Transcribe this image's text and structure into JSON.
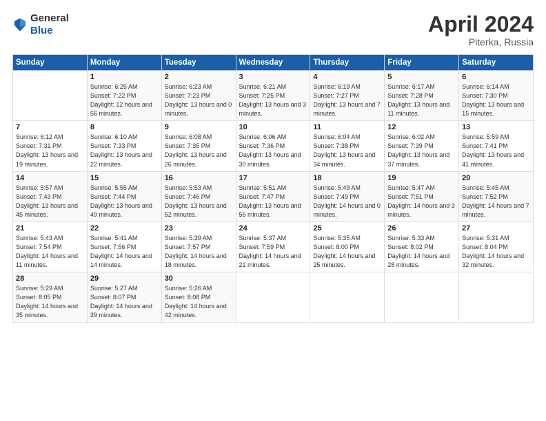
{
  "header": {
    "logo_general": "General",
    "logo_blue": "Blue",
    "title": "April 2024",
    "location": "Piterka, Russia"
  },
  "calendar": {
    "days_of_week": [
      "Sunday",
      "Monday",
      "Tuesday",
      "Wednesday",
      "Thursday",
      "Friday",
      "Saturday"
    ],
    "weeks": [
      [
        {
          "day": "",
          "info": ""
        },
        {
          "day": "1",
          "info": "Sunrise: 6:25 AM\nSunset: 7:22 PM\nDaylight: 12 hours\nand 56 minutes."
        },
        {
          "day": "2",
          "info": "Sunrise: 6:23 AM\nSunset: 7:23 PM\nDaylight: 13 hours\nand 0 minutes."
        },
        {
          "day": "3",
          "info": "Sunrise: 6:21 AM\nSunset: 7:25 PM\nDaylight: 13 hours\nand 3 minutes."
        },
        {
          "day": "4",
          "info": "Sunrise: 6:19 AM\nSunset: 7:27 PM\nDaylight: 13 hours\nand 7 minutes."
        },
        {
          "day": "5",
          "info": "Sunrise: 6:17 AM\nSunset: 7:28 PM\nDaylight: 13 hours\nand 11 minutes."
        },
        {
          "day": "6",
          "info": "Sunrise: 6:14 AM\nSunset: 7:30 PM\nDaylight: 13 hours\nand 15 minutes."
        }
      ],
      [
        {
          "day": "7",
          "info": "Sunrise: 6:12 AM\nSunset: 7:31 PM\nDaylight: 13 hours\nand 19 minutes."
        },
        {
          "day": "8",
          "info": "Sunrise: 6:10 AM\nSunset: 7:33 PM\nDaylight: 13 hours\nand 22 minutes."
        },
        {
          "day": "9",
          "info": "Sunrise: 6:08 AM\nSunset: 7:35 PM\nDaylight: 13 hours\nand 26 minutes."
        },
        {
          "day": "10",
          "info": "Sunrise: 6:06 AM\nSunset: 7:36 PM\nDaylight: 13 hours\nand 30 minutes."
        },
        {
          "day": "11",
          "info": "Sunrise: 6:04 AM\nSunset: 7:38 PM\nDaylight: 13 hours\nand 34 minutes."
        },
        {
          "day": "12",
          "info": "Sunrise: 6:02 AM\nSunset: 7:39 PM\nDaylight: 13 hours\nand 37 minutes."
        },
        {
          "day": "13",
          "info": "Sunrise: 5:59 AM\nSunset: 7:41 PM\nDaylight: 13 hours\nand 41 minutes."
        }
      ],
      [
        {
          "day": "14",
          "info": "Sunrise: 5:57 AM\nSunset: 7:43 PM\nDaylight: 13 hours\nand 45 minutes."
        },
        {
          "day": "15",
          "info": "Sunrise: 5:55 AM\nSunset: 7:44 PM\nDaylight: 13 hours\nand 49 minutes."
        },
        {
          "day": "16",
          "info": "Sunrise: 5:53 AM\nSunset: 7:46 PM\nDaylight: 13 hours\nand 52 minutes."
        },
        {
          "day": "17",
          "info": "Sunrise: 5:51 AM\nSunset: 7:47 PM\nDaylight: 13 hours\nand 56 minutes."
        },
        {
          "day": "18",
          "info": "Sunrise: 5:49 AM\nSunset: 7:49 PM\nDaylight: 14 hours\nand 0 minutes."
        },
        {
          "day": "19",
          "info": "Sunrise: 5:47 AM\nSunset: 7:51 PM\nDaylight: 14 hours\nand 3 minutes."
        },
        {
          "day": "20",
          "info": "Sunrise: 5:45 AM\nSunset: 7:52 PM\nDaylight: 14 hours\nand 7 minutes."
        }
      ],
      [
        {
          "day": "21",
          "info": "Sunrise: 5:43 AM\nSunset: 7:54 PM\nDaylight: 14 hours\nand 11 minutes."
        },
        {
          "day": "22",
          "info": "Sunrise: 5:41 AM\nSunset: 7:56 PM\nDaylight: 14 hours\nand 14 minutes."
        },
        {
          "day": "23",
          "info": "Sunrise: 5:39 AM\nSunset: 7:57 PM\nDaylight: 14 hours\nand 18 minutes."
        },
        {
          "day": "24",
          "info": "Sunrise: 5:37 AM\nSunset: 7:59 PM\nDaylight: 14 hours\nand 21 minutes."
        },
        {
          "day": "25",
          "info": "Sunrise: 5:35 AM\nSunset: 8:00 PM\nDaylight: 14 hours\nand 25 minutes."
        },
        {
          "day": "26",
          "info": "Sunrise: 5:33 AM\nSunset: 8:02 PM\nDaylight: 14 hours\nand 28 minutes."
        },
        {
          "day": "27",
          "info": "Sunrise: 5:31 AM\nSunset: 8:04 PM\nDaylight: 14 hours\nand 32 minutes."
        }
      ],
      [
        {
          "day": "28",
          "info": "Sunrise: 5:29 AM\nSunset: 8:05 PM\nDaylight: 14 hours\nand 35 minutes."
        },
        {
          "day": "29",
          "info": "Sunrise: 5:27 AM\nSunset: 8:07 PM\nDaylight: 14 hours\nand 39 minutes."
        },
        {
          "day": "30",
          "info": "Sunrise: 5:26 AM\nSunset: 8:08 PM\nDaylight: 14 hours\nand 42 minutes."
        },
        {
          "day": "",
          "info": ""
        },
        {
          "day": "",
          "info": ""
        },
        {
          "day": "",
          "info": ""
        },
        {
          "day": "",
          "info": ""
        }
      ]
    ]
  }
}
